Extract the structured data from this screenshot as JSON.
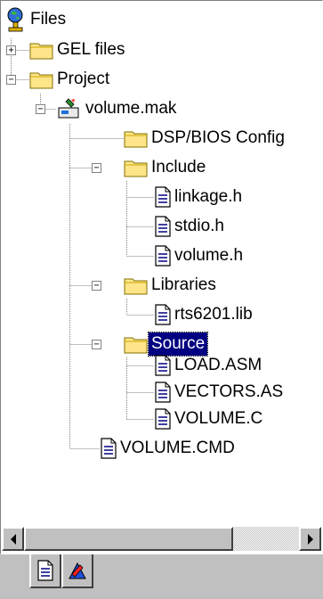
{
  "tree": {
    "root": {
      "label": "Files",
      "icon": "globe-person-icon"
    },
    "items": [
      {
        "label": "GEL files",
        "icon": "folder-icon",
        "toggle": "+"
      },
      {
        "label": "Project",
        "icon": "folder-open-icon",
        "toggle": "−"
      },
      {
        "label": "volume.mak",
        "icon": "project-icon",
        "toggle": "−"
      },
      {
        "label": "DSP/BIOS Config",
        "icon": "folder-icon"
      },
      {
        "label": "Include",
        "icon": "folder-open-icon",
        "toggle": "−"
      },
      {
        "label": "linkage.h",
        "icon": "file-icon"
      },
      {
        "label": "stdio.h",
        "icon": "file-icon"
      },
      {
        "label": "volume.h",
        "icon": "file-icon"
      },
      {
        "label": "Libraries",
        "icon": "folder-open-icon",
        "toggle": "−"
      },
      {
        "label": "rts6201.lib",
        "icon": "file-icon"
      },
      {
        "label": "Source",
        "icon": "folder-open-icon",
        "toggle": "−",
        "selected": true
      },
      {
        "label": "LOAD.ASM",
        "icon": "file-icon"
      },
      {
        "label": "VECTORS.AS",
        "icon": "file-icon"
      },
      {
        "label": "VOLUME.C",
        "icon": "file-icon"
      },
      {
        "label": "VOLUME.CMD",
        "icon": "file-icon"
      }
    ]
  },
  "scrollbar": {
    "left_icon": "scroll-left-arrow-icon",
    "right_icon": "scroll-right-arrow-icon"
  },
  "tabs": [
    {
      "icon": "file-view-tab-icon",
      "active": true
    },
    {
      "icon": "bookmark-view-tab-icon",
      "active": false
    }
  ],
  "colors": {
    "selection": "#000080",
    "folder": "#ffe58a",
    "face": "#c0c0c0"
  }
}
